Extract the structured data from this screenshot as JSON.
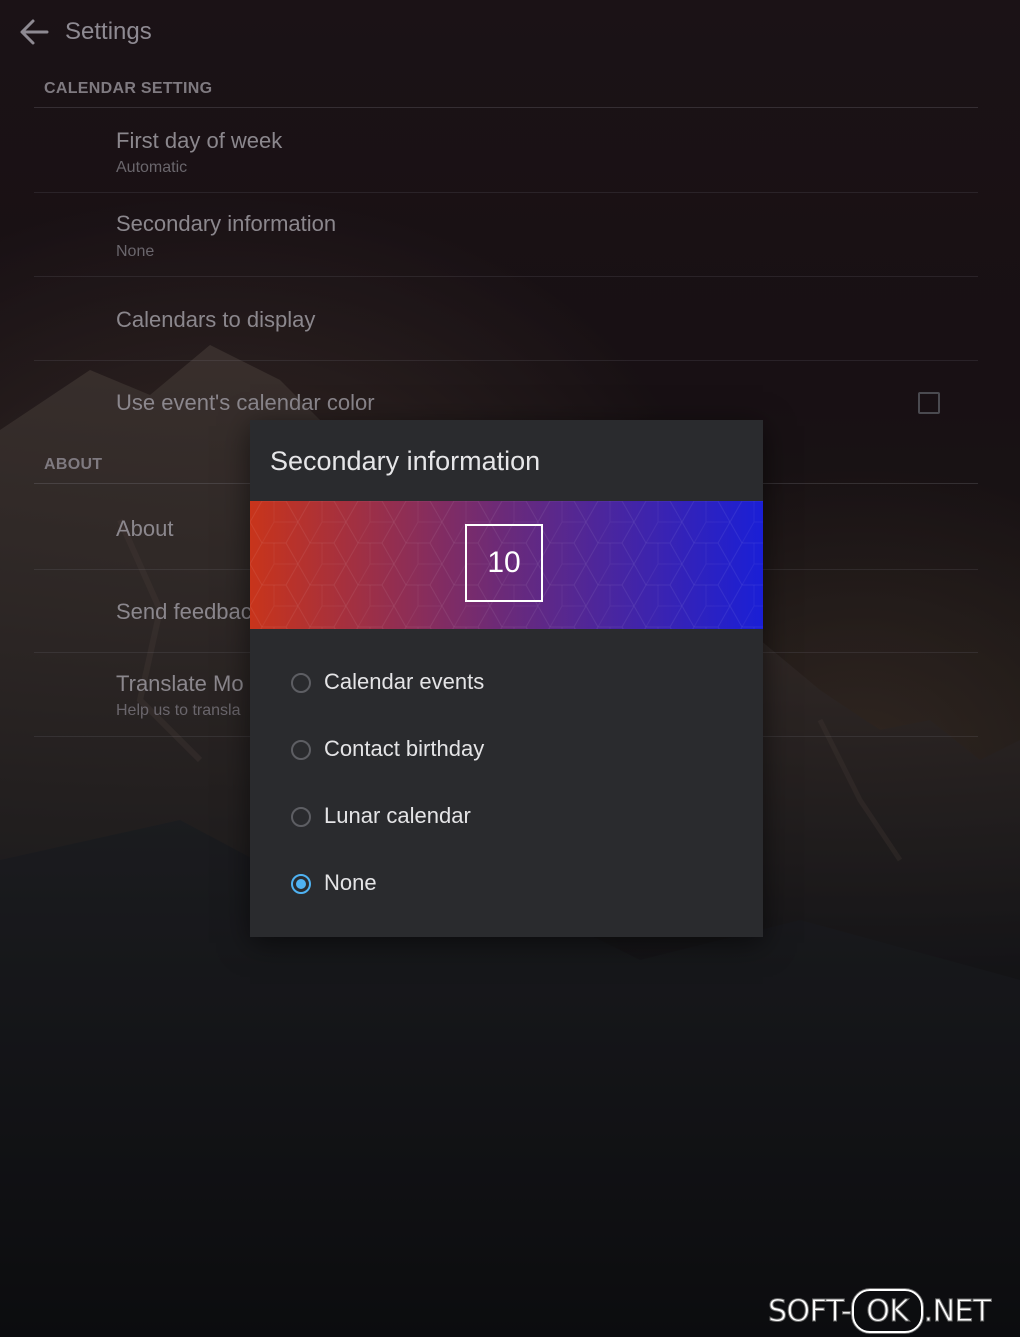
{
  "appbar": {
    "title": "Settings"
  },
  "calendar_setting": {
    "header": "CALENDAR SETTING",
    "items": [
      {
        "title": "First day of week",
        "summary": "Automatic"
      },
      {
        "title": "Secondary information",
        "summary": "None"
      },
      {
        "title": "Calendars to display"
      },
      {
        "title": "Use event's calendar color",
        "checked": false
      }
    ]
  },
  "about_section": {
    "header": "ABOUT",
    "items": [
      {
        "title": "About"
      },
      {
        "title": "Send feedbac"
      },
      {
        "title": "Translate Mo",
        "summary": "Help us to transla"
      }
    ]
  },
  "dialog": {
    "title": "Secondary information",
    "date_number": "10",
    "banner_colors": [
      "#c8341b",
      "#6a2a7a",
      "#1a1fd6"
    ],
    "options": [
      {
        "label": "Calendar events",
        "selected": false
      },
      {
        "label": "Contact birthday",
        "selected": false
      },
      {
        "label": "Lunar calendar",
        "selected": false
      },
      {
        "label": "None",
        "selected": true
      }
    ],
    "accent_color": "#4fb2f2"
  },
  "watermark": {
    "left": "SOFT-",
    "box": "OK",
    "right": ".NET"
  }
}
